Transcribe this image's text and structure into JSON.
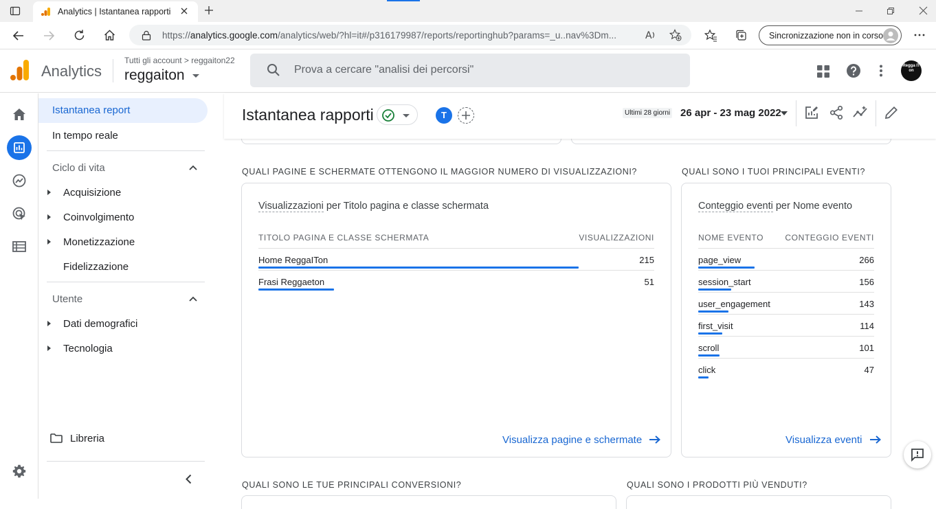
{
  "browser": {
    "tab_title": "Analytics | Istantanea rapporti",
    "url_prefix": "https://",
    "url_host": "analytics.google.com",
    "url_rest": "/analytics/web/?hl=it#/p316179987/reports/reportinghub?params=_u..nav%3Dm...",
    "sync_label": "Sincronizzazione non in corso"
  },
  "header": {
    "brand": "Analytics",
    "account_path": "Tutti gli account > reggaiton22",
    "property": "reggaiton",
    "search_placeholder": "Prova a cercare \"analisi dei percorsi\"",
    "avatar_text": "Regga IT on"
  },
  "sidenav": {
    "snapshot": "Istantanea report",
    "realtime": "In tempo reale",
    "lifecycle": "Ciclo di vita",
    "lifecycle_items": [
      "Acquisizione",
      "Coinvolgimento",
      "Monetizzazione",
      "Fidelizzazione"
    ],
    "user": "Utente",
    "user_items": [
      "Dati demografici",
      "Tecnologia"
    ],
    "library": "Libreria"
  },
  "main": {
    "title": "Istantanea rapporti",
    "user_badge": "T",
    "date_label": "Ultimi 28 giorni",
    "date_range": "26 apr - 23 mag 2022",
    "q_pages": "QUALI PAGINE E SCHERMATE OTTENGONO IL MAGGIOR NUMERO DI VISUALIZZAZIONI?",
    "q_events": "QUALI SONO I TUOI PRINCIPALI EVENTI?",
    "q_conversions": "QUALI SONO LE TUE PRINCIPALI CONVERSIONI?",
    "q_products": "QUALI SONO I PRODOTTI PIÙ VENDUTI?",
    "pages_card": {
      "title_metric": "Visualizzazioni",
      "title_rest": " per Titolo pagina e classe schermata",
      "col1": "TITOLO PAGINA E CLASSE SCHERMATA",
      "col2": "VISUALIZZAZIONI",
      "rows": [
        {
          "label": "Home ReggaITon",
          "value": 215,
          "share": 1.0
        },
        {
          "label": "Frasi Reggaeton",
          "value": 51,
          "share": 0.237
        }
      ],
      "link": "Visualizza pagine e schermate"
    },
    "events_card": {
      "title_metric": "Conteggio eventi",
      "title_rest": " per Nome evento",
      "col1": "NOME EVENTO",
      "col2": "CONTEGGIO EVENTI",
      "rows": [
        {
          "label": "page_view",
          "value": 266,
          "share": 1.0
        },
        {
          "label": "session_start",
          "value": 156,
          "share": 0.586
        },
        {
          "label": "user_engagement",
          "value": 143,
          "share": 0.538
        },
        {
          "label": "first_visit",
          "value": 114,
          "share": 0.429
        },
        {
          "label": "scroll",
          "value": 101,
          "share": 0.38
        },
        {
          "label": "click",
          "value": 47,
          "share": 0.177
        }
      ],
      "link": "Visualizza eventi"
    }
  },
  "colors": {
    "accent": "#1a73e8",
    "link": "#1967d2",
    "active_nav": "#e8f0fe",
    "orange": "#f9ab00",
    "orange_dark": "#e37400"
  }
}
